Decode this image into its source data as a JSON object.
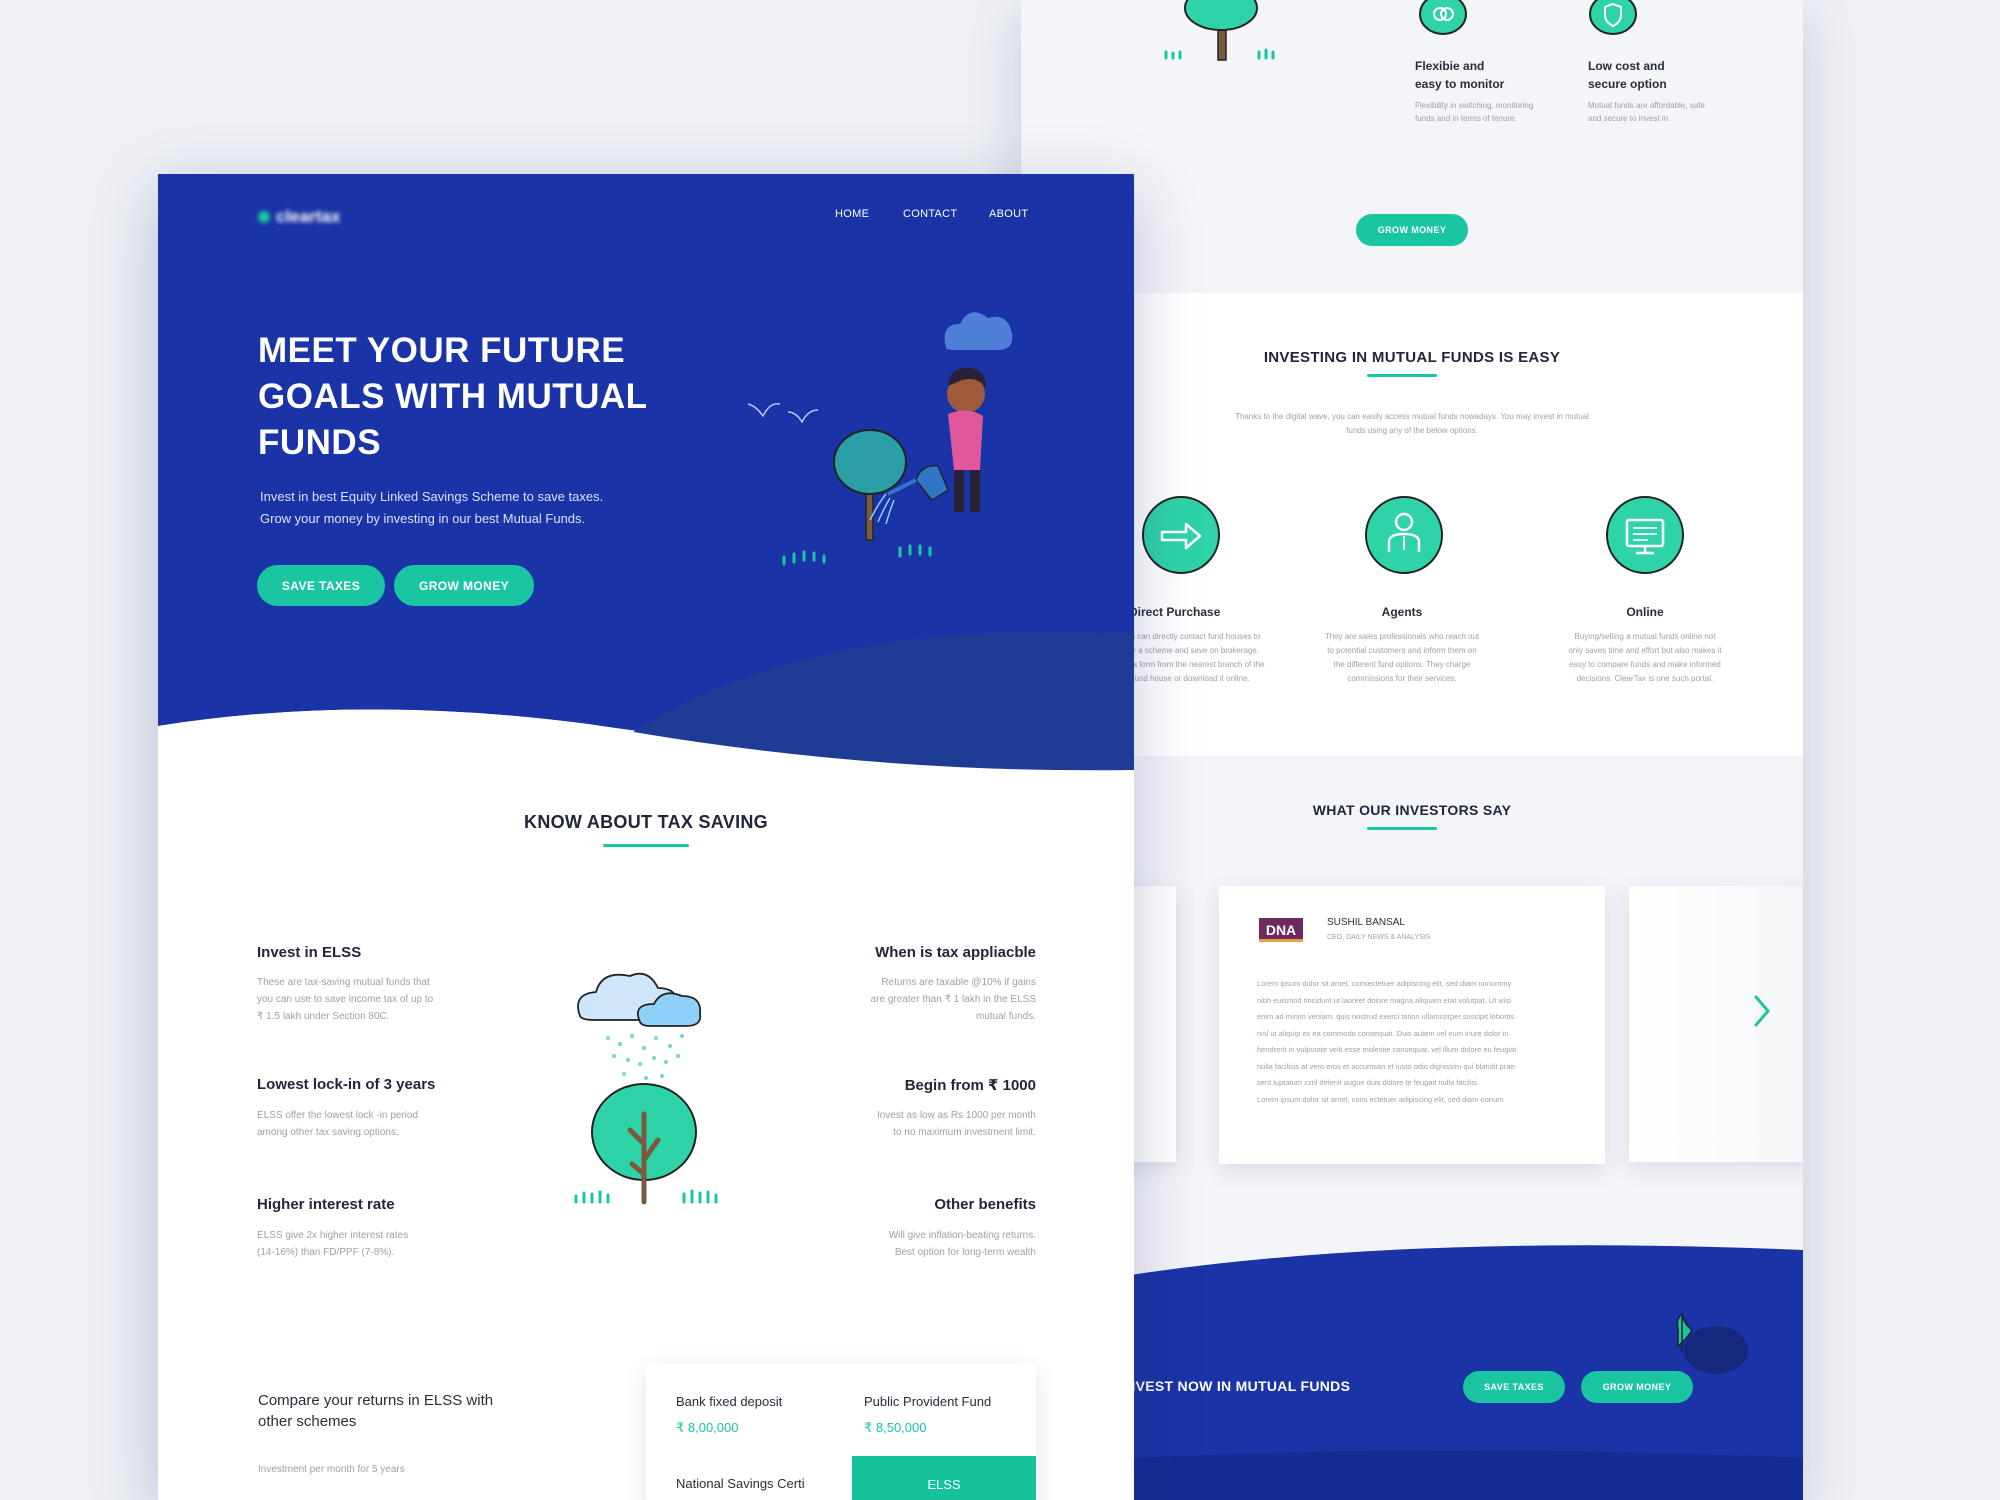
{
  "back": {
    "features": [
      {
        "icon": "swap-icon",
        "title_l1": "Flexibie and",
        "title_l2": "easy to monitor",
        "text_l1": "Flexibility in switching, monitoring",
        "text_l2": "funds and in terms of tenure."
      },
      {
        "icon": "shield-icon",
        "title_l1": "Low cost and",
        "title_l2": "secure option",
        "text_l1": "Mutual funds are affordable, safe",
        "text_l2": "and secure to invest in."
      }
    ],
    "grow_button": "GROW MONEY",
    "investing": {
      "title": "INVESTING IN MUTUAL FUNDS IS EASY",
      "desc_l1": "Thanks to the digital wave, you can easily access mutual funds nowadays. You may invest in mutual",
      "desc_l2": "funds using any of the below options.",
      "options": [
        {
          "icon": "arrow-right-icon",
          "title": "Direct Purchase",
          "lines": [
            "You can directly contact fund houses to",
            "buy a scheme and save on brokerage.",
            "Get a form from the nearest branch of the",
            "fund house or download it online."
          ]
        },
        {
          "icon": "agent-icon",
          "title": "Agents",
          "lines": [
            "They are sales professionals who reach out",
            "to potential customers and inform them on",
            "the different fund options. They charge",
            "commissions for their services."
          ]
        },
        {
          "icon": "monitor-icon",
          "title": "Online",
          "lines": [
            "Buying/selling a mutual funds online not",
            "only saves time and effort but also makes it",
            "easy to compare funds and make informed",
            "decisions. ClearTax is one such portal."
          ]
        }
      ]
    },
    "testimonials": {
      "title": "WHAT OUR INVESTORS SAY",
      "logo": "DNA",
      "name": "SUSHIL BANSAL",
      "role": "CEO, DAILY NEWS & ANALYSIS",
      "lines": [
        "Lorem ipsum dolor sit amet, consectetuer adipiscing elit, sed diam nonummy",
        "nibh euismod tincidunt ut laoreet dolore magna aliquam erat volutpat. Ut wisi",
        "enim ad minim veniam, quis nostrud exerci tation ullamcorper suscipit lobortis",
        "nisl ut aliquip ex ea commodo consequat. Duis autem vel eum iriure dolor in",
        "hendrerit in vulputate velit esse molestie consequat, vel illum dolore eu feugiat",
        "nulla facilisis at vero eros et accumsan et iusto odio dignissim qui blandit prae-",
        "sent luptatum zzril delenit augue duis dolore te feugait nulla facilisi.",
        "Lorem ipsum dolor sit amet, cons ectetuer adipiscing elit, sed diam nonum"
      ]
    },
    "cta": {
      "text": "INVEST NOW IN MUTUAL FUNDS",
      "save": "SAVE TAXES",
      "grow": "GROW MONEY"
    }
  },
  "front": {
    "logo": "cleartax",
    "nav": [
      "HOME",
      "CONTACT",
      "ABOUT"
    ],
    "hero": {
      "title_l1": "MEET YOUR FUTURE",
      "title_l2": "GOALS WITH MUTUAL",
      "title_l3": "FUNDS",
      "sub_l1": "Invest in best Equity Linked Savings Scheme to save taxes.",
      "sub_l2": "Grow your money by investing in our best Mutual Funds.",
      "save": "SAVE TAXES",
      "grow": "GROW MONEY"
    },
    "tax": {
      "title": "KNOW ABOUT TAX SAVING",
      "left": [
        {
          "title": "Invest in ELSS",
          "lines": [
            "These are tax-saving mutual funds that",
            "you can use to save income tax of up to",
            "₹ 1.5 lakh under Section 80C."
          ]
        },
        {
          "title": "Lowest lock-in of 3 years",
          "lines": [
            "ELSS offer the lowest lock -in period",
            "among other tax saving options."
          ]
        },
        {
          "title": "Higher interest rate",
          "lines": [
            "ELSS give 2x higher interest rates",
            "(14-16%) than FD/PPF (7-8%)."
          ]
        }
      ],
      "right": [
        {
          "title": "When is tax appliacble",
          "lines": [
            "Returns are taxable @10% if gains",
            "are greater than ₹ 1 lakh in the ELSS",
            "mutual funds."
          ]
        },
        {
          "title": "Begin from ₹ 1000",
          "lines": [
            "Invest as low as Rs 1000 per month",
            "to no maximum investment limit."
          ]
        },
        {
          "title": "Other benefits",
          "lines": [
            "Will give inflation-beating returns.",
            "Best option for long-term wealth"
          ]
        }
      ]
    },
    "compare": {
      "title_l1": "Compare your returns in ELSS with",
      "title_l2": "other schemes",
      "sub": "Investment per month for 5 years",
      "items": [
        {
          "label": "Bank fixed deposit",
          "value": "₹ 8,00,000"
        },
        {
          "label": "Public Provident Fund",
          "value": "₹ 8,50,000"
        },
        {
          "label": "National Savings Certi",
          "value": ""
        },
        {
          "label": "ELSS",
          "value": ""
        }
      ]
    }
  }
}
